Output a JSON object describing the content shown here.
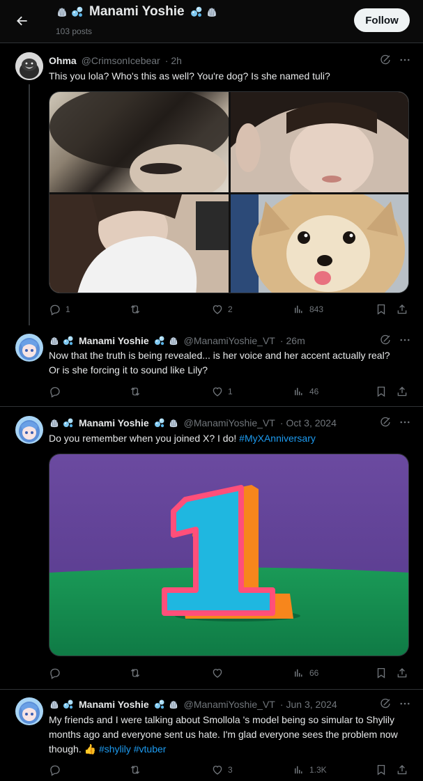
{
  "header": {
    "title": "Manami Yoshie",
    "posts": "103 posts",
    "follow_label": "Follow"
  },
  "tweets": [
    {
      "name": "Ohma",
      "handle": "@CrimsonIcebear",
      "time": "2h",
      "text": "This you lola? Who's this as well? You're dog? Is she named tuli?",
      "replies": "1",
      "retweets": "",
      "likes": "2",
      "views": "843"
    },
    {
      "name": "Manami Yoshie",
      "handle": "@ManamiYoshie_VT",
      "time": "26m",
      "text": "Now that the truth is being revealed... is her voice and her accent actually real? Or is she forcing it to sound like Lily?",
      "replies": "",
      "retweets": "",
      "likes": "1",
      "views": "46"
    },
    {
      "name": "Manami Yoshie",
      "handle": "@ManamiYoshie_VT",
      "time": "Oct 3, 2024",
      "text": "Do you remember when you joined X? I do! ",
      "hashtag": "#MyXAnniversary",
      "replies": "",
      "retweets": "",
      "likes": "",
      "views": "66"
    },
    {
      "name": "Manami Yoshie",
      "handle": "@ManamiYoshie_VT",
      "time": "Jun 3, 2024",
      "text": "My friends and I were talking about Smollola 's model being so simular to Shylily months ago and everyone sent us hate. I'm glad everyone sees the problem now though. ",
      "emoji": "👍",
      "hashtags": "#shylily #vtuber",
      "replies": "",
      "retweets": "",
      "likes": "3",
      "views": "1.3K"
    }
  ],
  "colors": {
    "background": "#000000",
    "text": "#e7e9ea",
    "muted": "#71767b",
    "link": "#1d9bf0",
    "divider": "#2f3336"
  }
}
